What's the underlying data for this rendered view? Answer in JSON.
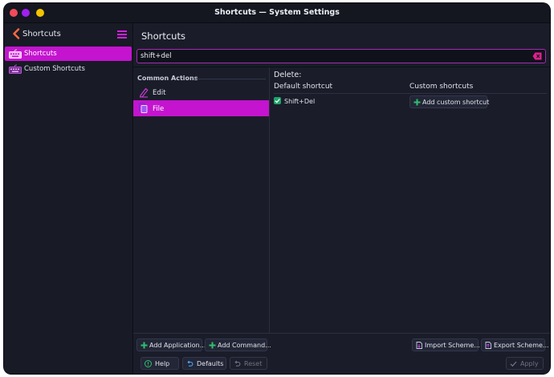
{
  "window": {
    "title": "Shortcuts — System Settings"
  },
  "sidebar": {
    "title": "Shortcuts",
    "items": [
      {
        "label": "Shortcuts",
        "selected": true
      },
      {
        "label": "Custom Shortcuts",
        "selected": false
      }
    ]
  },
  "main": {
    "title": "Shortcuts",
    "search": {
      "value": "shift+del",
      "placeholder": ""
    },
    "list": {
      "header": "Common Actions",
      "items": [
        {
          "label": "Edit",
          "selected": false
        },
        {
          "label": "File",
          "selected": true
        }
      ]
    },
    "detail": {
      "title": "Delete:",
      "default_header": "Default shortcut",
      "custom_header": "Custom shortcuts",
      "default_shortcut": "Shift+Del",
      "default_checked": true,
      "add_custom_label": "Add custom shortcut"
    }
  },
  "footer": {
    "add_application": "Add Application...",
    "add_command": "Add Command...",
    "import_scheme": "Import Scheme...",
    "export_scheme": "Export Scheme...",
    "help": "Help",
    "defaults": "Defaults",
    "reset": "Reset",
    "apply": "Apply"
  },
  "colors": {
    "accent": "#c414cf",
    "window_bg": "#1a1d29",
    "sidebar_bg": "#181a26",
    "green": "#2fbf71",
    "close": "#f24b5a",
    "minimize": "#a020f0",
    "maximize": "#f5c400"
  }
}
